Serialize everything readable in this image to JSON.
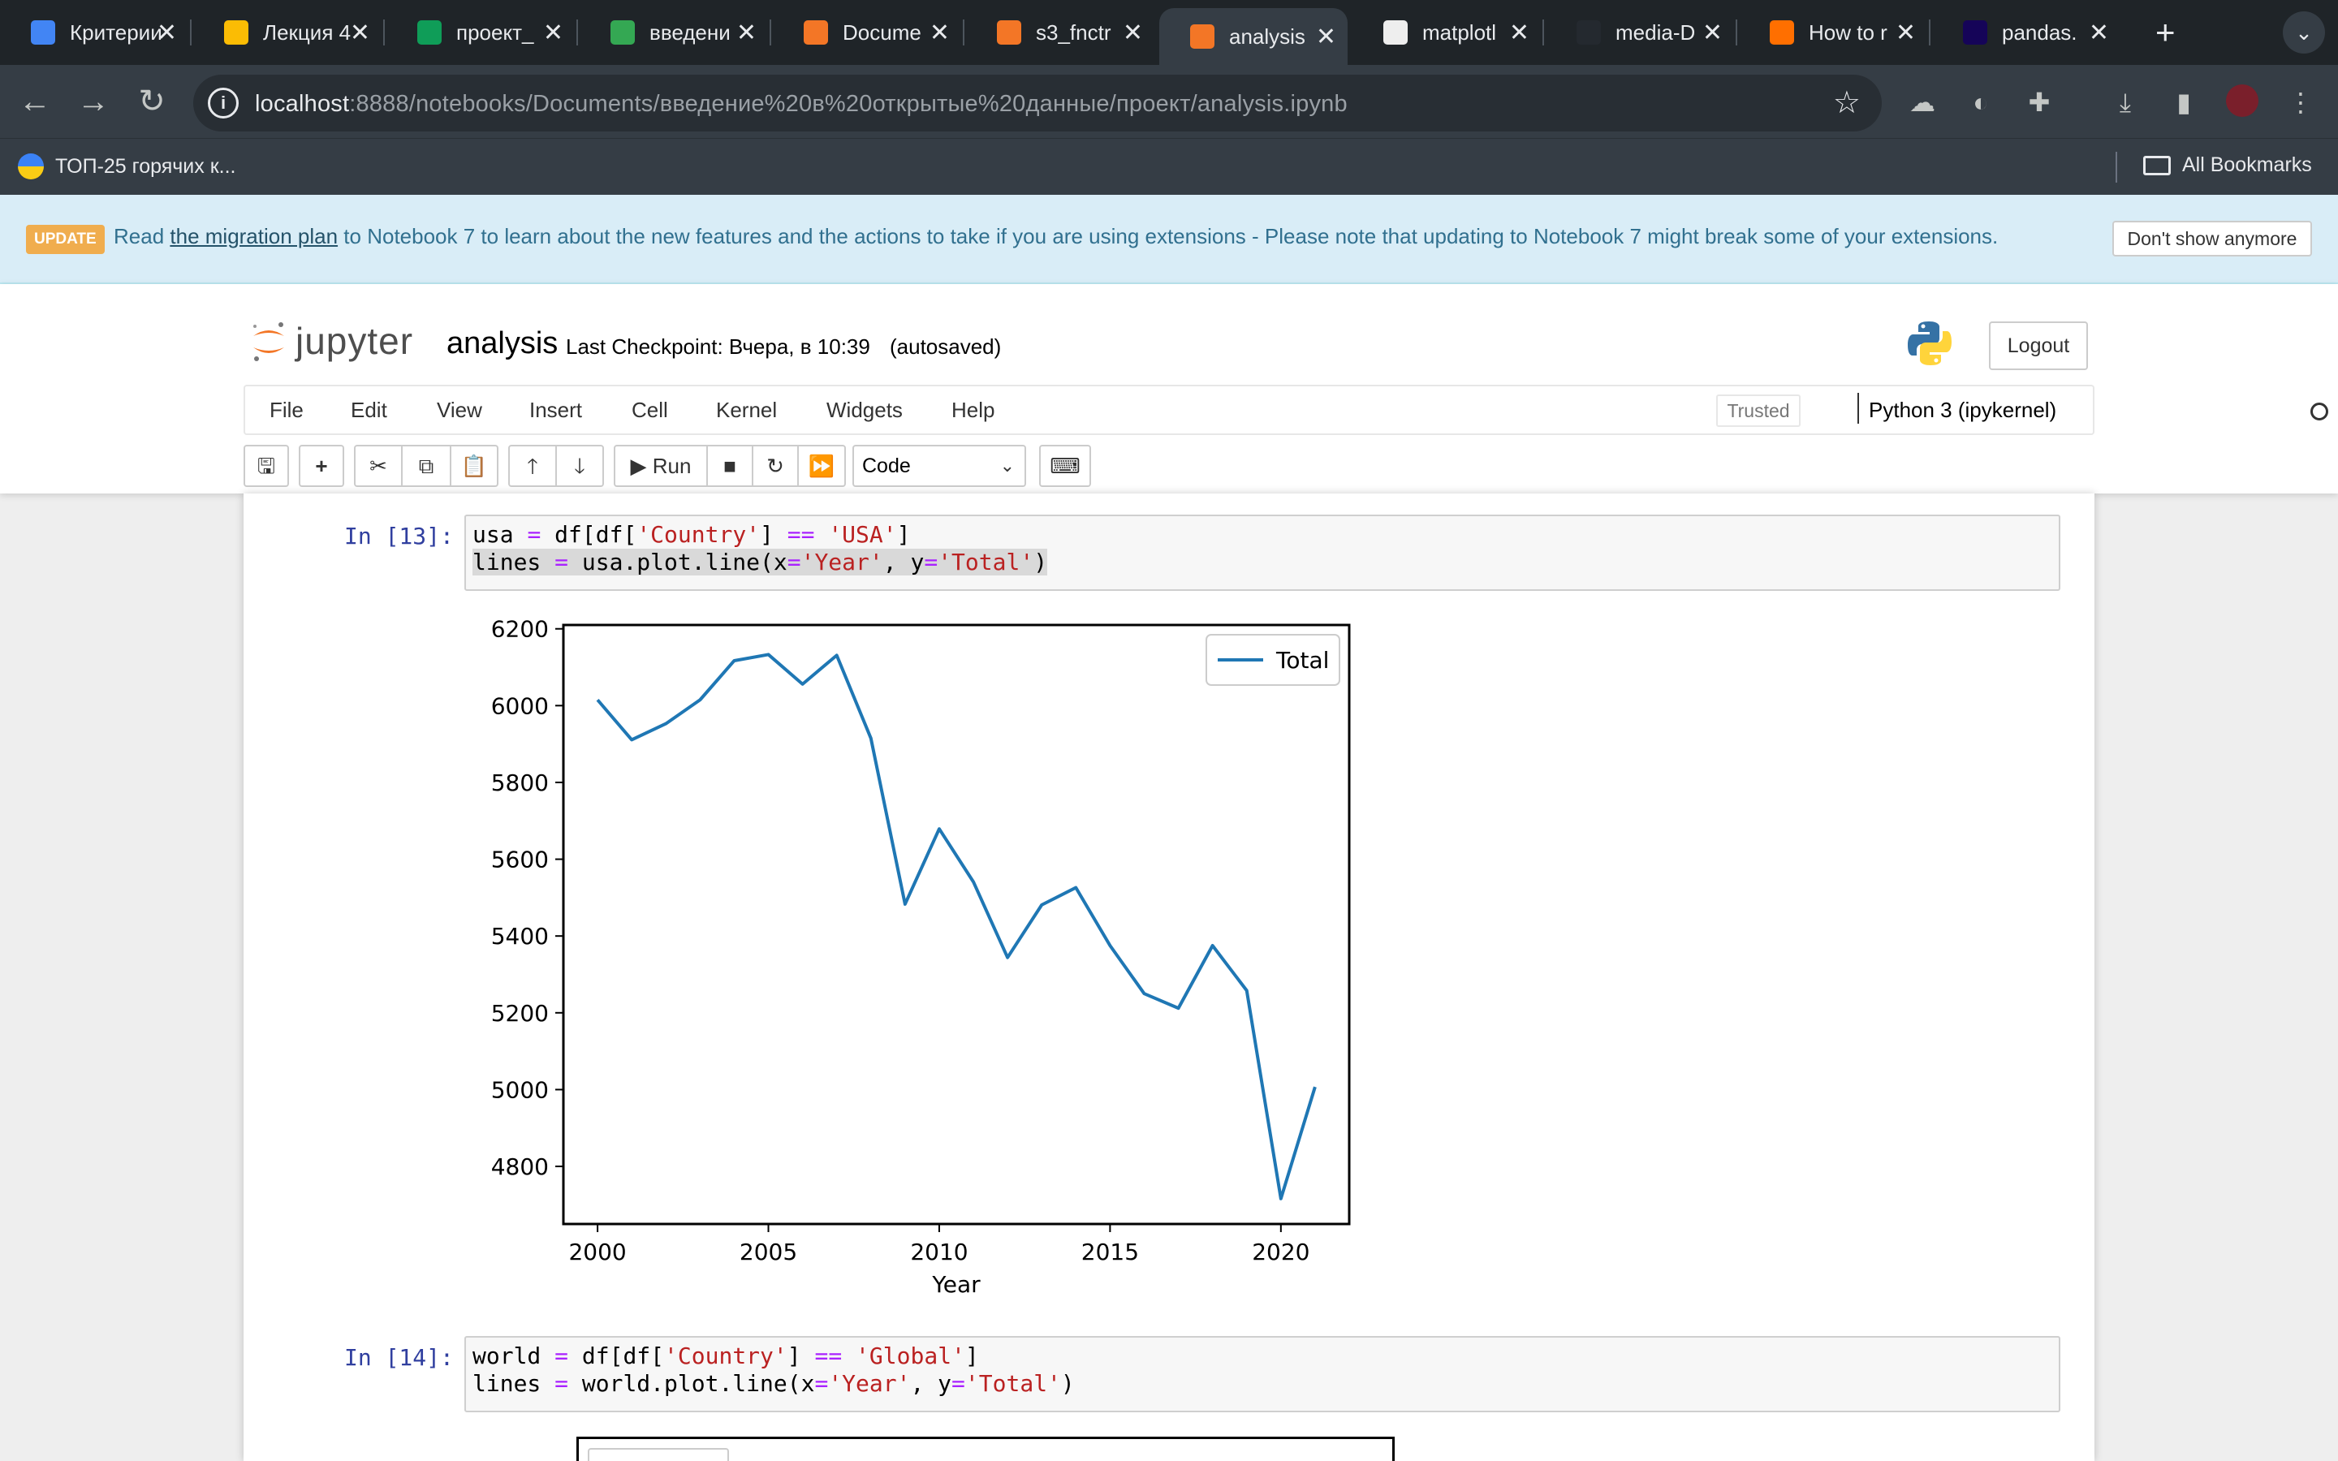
{
  "browser": {
    "tabs": [
      {
        "title": "Критерии",
        "color": "#4285f4"
      },
      {
        "title": "Лекция 4",
        "color": "#fbbc04"
      },
      {
        "title": "проект_",
        "color": "#0f9d58"
      },
      {
        "title": "введени",
        "color": "#34a853"
      },
      {
        "title": "Docume",
        "color": "#f37626"
      },
      {
        "title": "s3_fnctr",
        "color": "#f37626"
      },
      {
        "title": "analysis",
        "color": "#f37626"
      },
      {
        "title": "matplotl",
        "color": "#eeeeee"
      },
      {
        "title": "media-D",
        "color": "#24292f"
      },
      {
        "title": "How to r",
        "color": "#ff6f00"
      },
      {
        "title": "pandas.",
        "color": "#150458"
      }
    ],
    "active_tab_index": 6,
    "url_host": "localhost",
    "url_path": ":8888/notebooks/Documents/введение%20в%20открытые%20данные/проект/analysis.ipynb",
    "bookmark_1": "ТОП-25 горячих к...",
    "all_bookmarks": "All Bookmarks"
  },
  "banner": {
    "badge": "UPDATE",
    "text_before": "Read ",
    "link": "the migration plan",
    "text_after": " to Notebook 7 to learn about the new features and the actions to take if you are using extensions - Please note that updating to Notebook 7 might break some of your extensions.",
    "dismiss": "Don't show anymore"
  },
  "jupyter": {
    "logo_word": "jupyter",
    "notebook_name": "analysis",
    "checkpoint": "Last Checkpoint: Вчера, в 10:39",
    "autosaved": "(autosaved)",
    "logout": "Logout",
    "menu": [
      "File",
      "Edit",
      "View",
      "Insert",
      "Cell",
      "Kernel",
      "Widgets",
      "Help"
    ],
    "trusted": "Trusted",
    "kernel": "Python 3 (ipykernel)",
    "run_label": "Run",
    "cell_type": "Code"
  },
  "cells": [
    {
      "prompt": "In [13]:",
      "line1": {
        "a": "usa ",
        "op1": "=",
        "b": " df[df[",
        "s1": "'Country'",
        "c": "] ",
        "op2": "==",
        "d": " ",
        "s2": "'USA'",
        "e": "]"
      },
      "line2": {
        "a": "lines ",
        "op1": "=",
        "b": " usa.plot.line(x",
        "op2": "=",
        "s1": "'Year'",
        "c": ", y",
        "op3": "=",
        "s2": "'Total'",
        "d": ")"
      }
    },
    {
      "prompt": "In [14]:",
      "line1": {
        "a": "world ",
        "op1": "=",
        "b": " df[df[",
        "s1": "'Country'",
        "c": "] ",
        "op2": "==",
        "d": " ",
        "s2": "'Global'",
        "e": "]"
      },
      "line2": {
        "a": "lines ",
        "op1": "=",
        "b": " world.plot.line(x",
        "op2": "=",
        "s1": "'Year'",
        "c": ", y",
        "op3": "=",
        "s2": "'Total'",
        "d": ")"
      }
    }
  ],
  "chart_data": {
    "type": "line",
    "xlabel": "Year",
    "ylabel": "",
    "xlim": [
      1999,
      2022
    ],
    "ylim": [
      4650,
      6210
    ],
    "xticks": [
      2000,
      2005,
      2010,
      2015,
      2020
    ],
    "yticks": [
      4800,
      5000,
      5200,
      5400,
      5600,
      5800,
      6000,
      6200
    ],
    "legend": "top-right",
    "grid": false,
    "x": [
      2000,
      2001,
      2002,
      2003,
      2004,
      2005,
      2006,
      2007,
      2008,
      2009,
      2010,
      2011,
      2012,
      2013,
      2014,
      2015,
      2016,
      2017,
      2018,
      2019,
      2020,
      2021
    ],
    "series": [
      {
        "name": "Total",
        "color": "#1f77b4",
        "values": [
          6015,
          5911,
          5953,
          6015,
          6117,
          6133,
          6056,
          6131,
          5915,
          5483,
          5679,
          5541,
          5344,
          5481,
          5526,
          5375,
          5250,
          5212,
          5375,
          5258,
          4716,
          5007
        ]
      }
    ]
  }
}
